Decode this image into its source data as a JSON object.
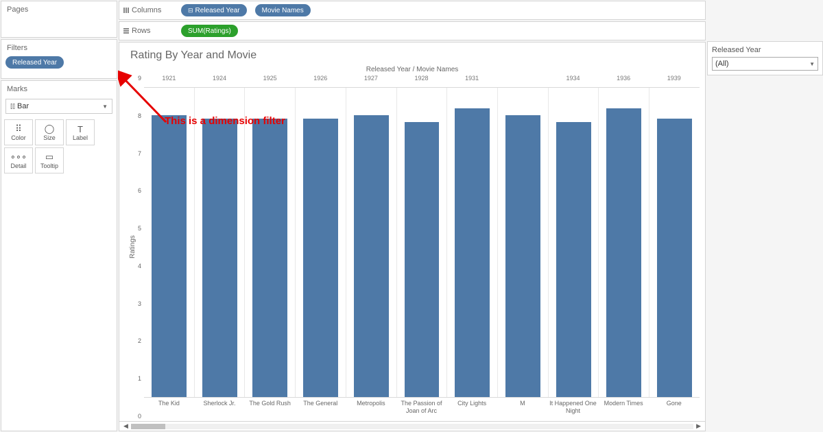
{
  "pages_label": "Pages",
  "filters_label": "Filters",
  "filter_pill": "Released Year",
  "marks_label": "Marks",
  "marks_type": "Bar",
  "marks_cells": [
    {
      "icon": "⠿",
      "label": "Color"
    },
    {
      "icon": "◯",
      "label": "Size"
    },
    {
      "icon": "T",
      "label": "Label"
    },
    {
      "icon": "∘∘∘",
      "label": "Detail"
    },
    {
      "icon": "▭",
      "label": "Tooltip"
    }
  ],
  "columns_label": "Columns",
  "rows_label": "Rows",
  "columns_pills": [
    {
      "text": "Released Year",
      "sym": "⊟",
      "color": "blue"
    },
    {
      "text": "Movie Names",
      "sym": "",
      "color": "blue"
    }
  ],
  "rows_pills": [
    {
      "text": "SUM(Ratings)",
      "sym": "",
      "color": "green"
    }
  ],
  "viz_title": "Rating By Year and Movie",
  "col_header": "Released Year / Movie Names",
  "y_axis_label": "Ratings",
  "right_filter_title": "Released Year",
  "right_filter_value": "(All)",
  "annotation_text": "This is a dimension filter",
  "chart_data": {
    "type": "bar",
    "title": "Rating By Year and Movie",
    "xlabel_top": "Released Year / Movie Names",
    "ylabel": "Ratings",
    "ylim": [
      0,
      9
    ],
    "yticks": [
      9,
      8,
      7,
      6,
      5,
      4,
      3,
      2,
      1,
      0
    ],
    "years": [
      "1921",
      "1924",
      "1925",
      "1926",
      "1927",
      "1928",
      "1931",
      "",
      "1934",
      "1936",
      "1939"
    ],
    "movies": [
      "The Kid",
      "Sherlock Jr.",
      "The Gold Rush",
      "The General",
      "Metropolis",
      "The Passion of Joan of Arc",
      "City Lights",
      "M",
      "It Happened One Night",
      "Modern Times",
      "Gone"
    ],
    "values": [
      8.2,
      8.1,
      8.1,
      8.1,
      8.2,
      8.0,
      8.4,
      8.2,
      8.0,
      8.4,
      8.1
    ]
  }
}
